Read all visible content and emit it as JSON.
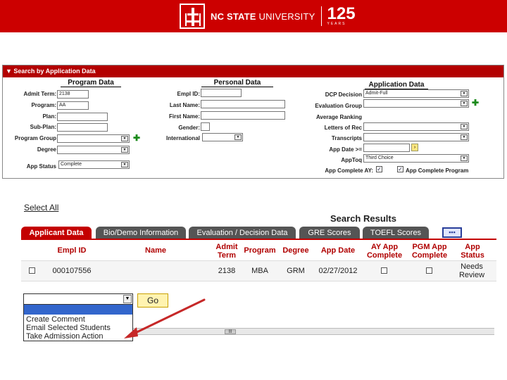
{
  "header": {
    "brand_bold": "NC STATE",
    "brand_rest": " UNIVERSITY",
    "anniversary": "125",
    "anniversary_sub": "YEARS",
    "bg_color": "#cc0000"
  },
  "search": {
    "bar_label": "▼ Search by Application Data",
    "program_data": {
      "title": "Program Data",
      "admit_term_label": "Admit Term:",
      "admit_term_value": "2138",
      "program_label": "Program:",
      "program_value": "AA",
      "plan_label": "Plan:",
      "sub_plan_label": "Sub-Plan:",
      "program_group_label": "Program Group",
      "degree_label": "Degree",
      "app_status_label": "App Status",
      "app_status_value": "Complete"
    },
    "personal_data": {
      "title": "Personal Data",
      "empl_id_label": "Empl ID:",
      "last_name_label": "Last Name:",
      "first_name_label": "First Name:",
      "gender_label": "Gender:",
      "international_label": "International"
    },
    "application_data": {
      "title": "Application Data",
      "dcp_decision_label": "DCP Decision",
      "dcp_decision_value": "Admit-Full",
      "evaluation_group_label": "Evaluation Group",
      "average_ranking_label": "Average Ranking",
      "letters_label": "Letters of Rec",
      "transcripts_label": "Transcripts",
      "app_date_label": "App Date >=",
      "apptoq_label": "AppToq",
      "apptoq_value": "Third Choice",
      "app_complete_ay_label": "App Complete AY:",
      "app_complete_program_label": "App Complete Program"
    }
  },
  "results": {
    "select_all": "Select All",
    "title": "Search Results",
    "tabs": [
      "Applicant Data",
      "Bio/Demo Information",
      "Evaluation / Decision Data",
      "GRE Scores",
      "TOEFL Scores"
    ],
    "columns": [
      "Empl ID",
      "Name",
      "Admit Term",
      "Program",
      "Degree",
      "App Date",
      "AY App Complete",
      "PGM App Complete",
      "App Status"
    ],
    "rows": [
      {
        "empl_id": "000107556",
        "name": "",
        "admit_term": "2138",
        "program": "MBA",
        "degree": "GRM",
        "app_date": "02/27/2012",
        "app_status": "Needs Review"
      }
    ]
  },
  "action": {
    "go_label": "Go",
    "options": [
      "Create Comment",
      "Email Selected Students",
      "Take Admission Action"
    ]
  }
}
